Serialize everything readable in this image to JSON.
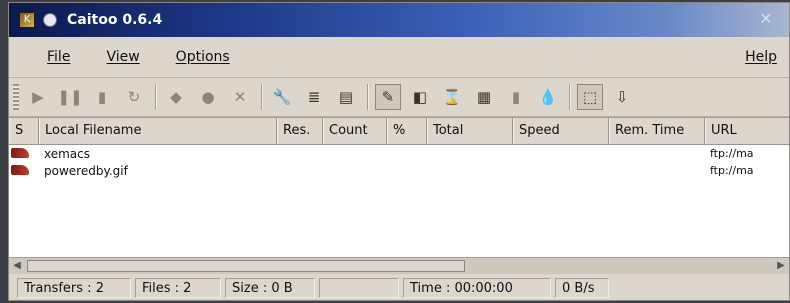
{
  "window": {
    "title": "Caitoo 0.6.4",
    "close_glyph": "✕"
  },
  "menu": {
    "file": "File",
    "view": "View",
    "options": "Options",
    "help": "Help"
  },
  "toolbar": {
    "buttons": [
      {
        "name": "play-icon",
        "glyph": "▶",
        "active": false
      },
      {
        "name": "pause-icon",
        "glyph": "❚❚",
        "active": false
      },
      {
        "name": "trash-icon",
        "glyph": "▮",
        "active": false
      },
      {
        "name": "refresh-icon",
        "glyph": "↻",
        "active": false
      },
      {
        "name": "eraser-icon",
        "glyph": "◆",
        "active": false
      },
      {
        "name": "record-icon",
        "glyph": "●",
        "active": false
      },
      {
        "name": "cancel-icon",
        "glyph": "✕",
        "active": false
      },
      {
        "name": "wrench-icon",
        "glyph": "🔧",
        "active": true
      },
      {
        "name": "list-icon",
        "glyph": "≣",
        "active": true
      },
      {
        "name": "clipboard-icon",
        "glyph": "▤",
        "active": true
      },
      {
        "name": "expert-mode-icon",
        "glyph": "✎",
        "active": true,
        "pressed": true
      },
      {
        "name": "docked-icon",
        "glyph": "◧",
        "active": true
      },
      {
        "name": "drop-target-icon",
        "glyph": "⌛",
        "active": true
      },
      {
        "name": "transfer-window-icon",
        "glyph": "▦",
        "active": true
      },
      {
        "name": "offline-icon",
        "glyph": "▮",
        "active": false
      },
      {
        "name": "drop-icon",
        "glyph": "💧",
        "active": true
      },
      {
        "name": "select-icon",
        "glyph": "⬚",
        "active": true,
        "pressed": true
      },
      {
        "name": "download-icon",
        "glyph": "⇩",
        "active": true
      }
    ]
  },
  "table": {
    "headers": [
      "S",
      "Local Filename",
      "Res.",
      "Count",
      "%",
      "Total",
      "Speed",
      "Rem. Time",
      "URL"
    ],
    "rows": [
      {
        "filename": "xemacs",
        "url": "ftp://ma"
      },
      {
        "filename": "poweredby.gif",
        "url": "ftp://ma"
      }
    ]
  },
  "statusbar": {
    "transfers": "Transfers : 2",
    "files": "Files : 2",
    "size": "Size : 0 B",
    "time": "Time : 00:00:00",
    "rate": "0 B/s"
  }
}
